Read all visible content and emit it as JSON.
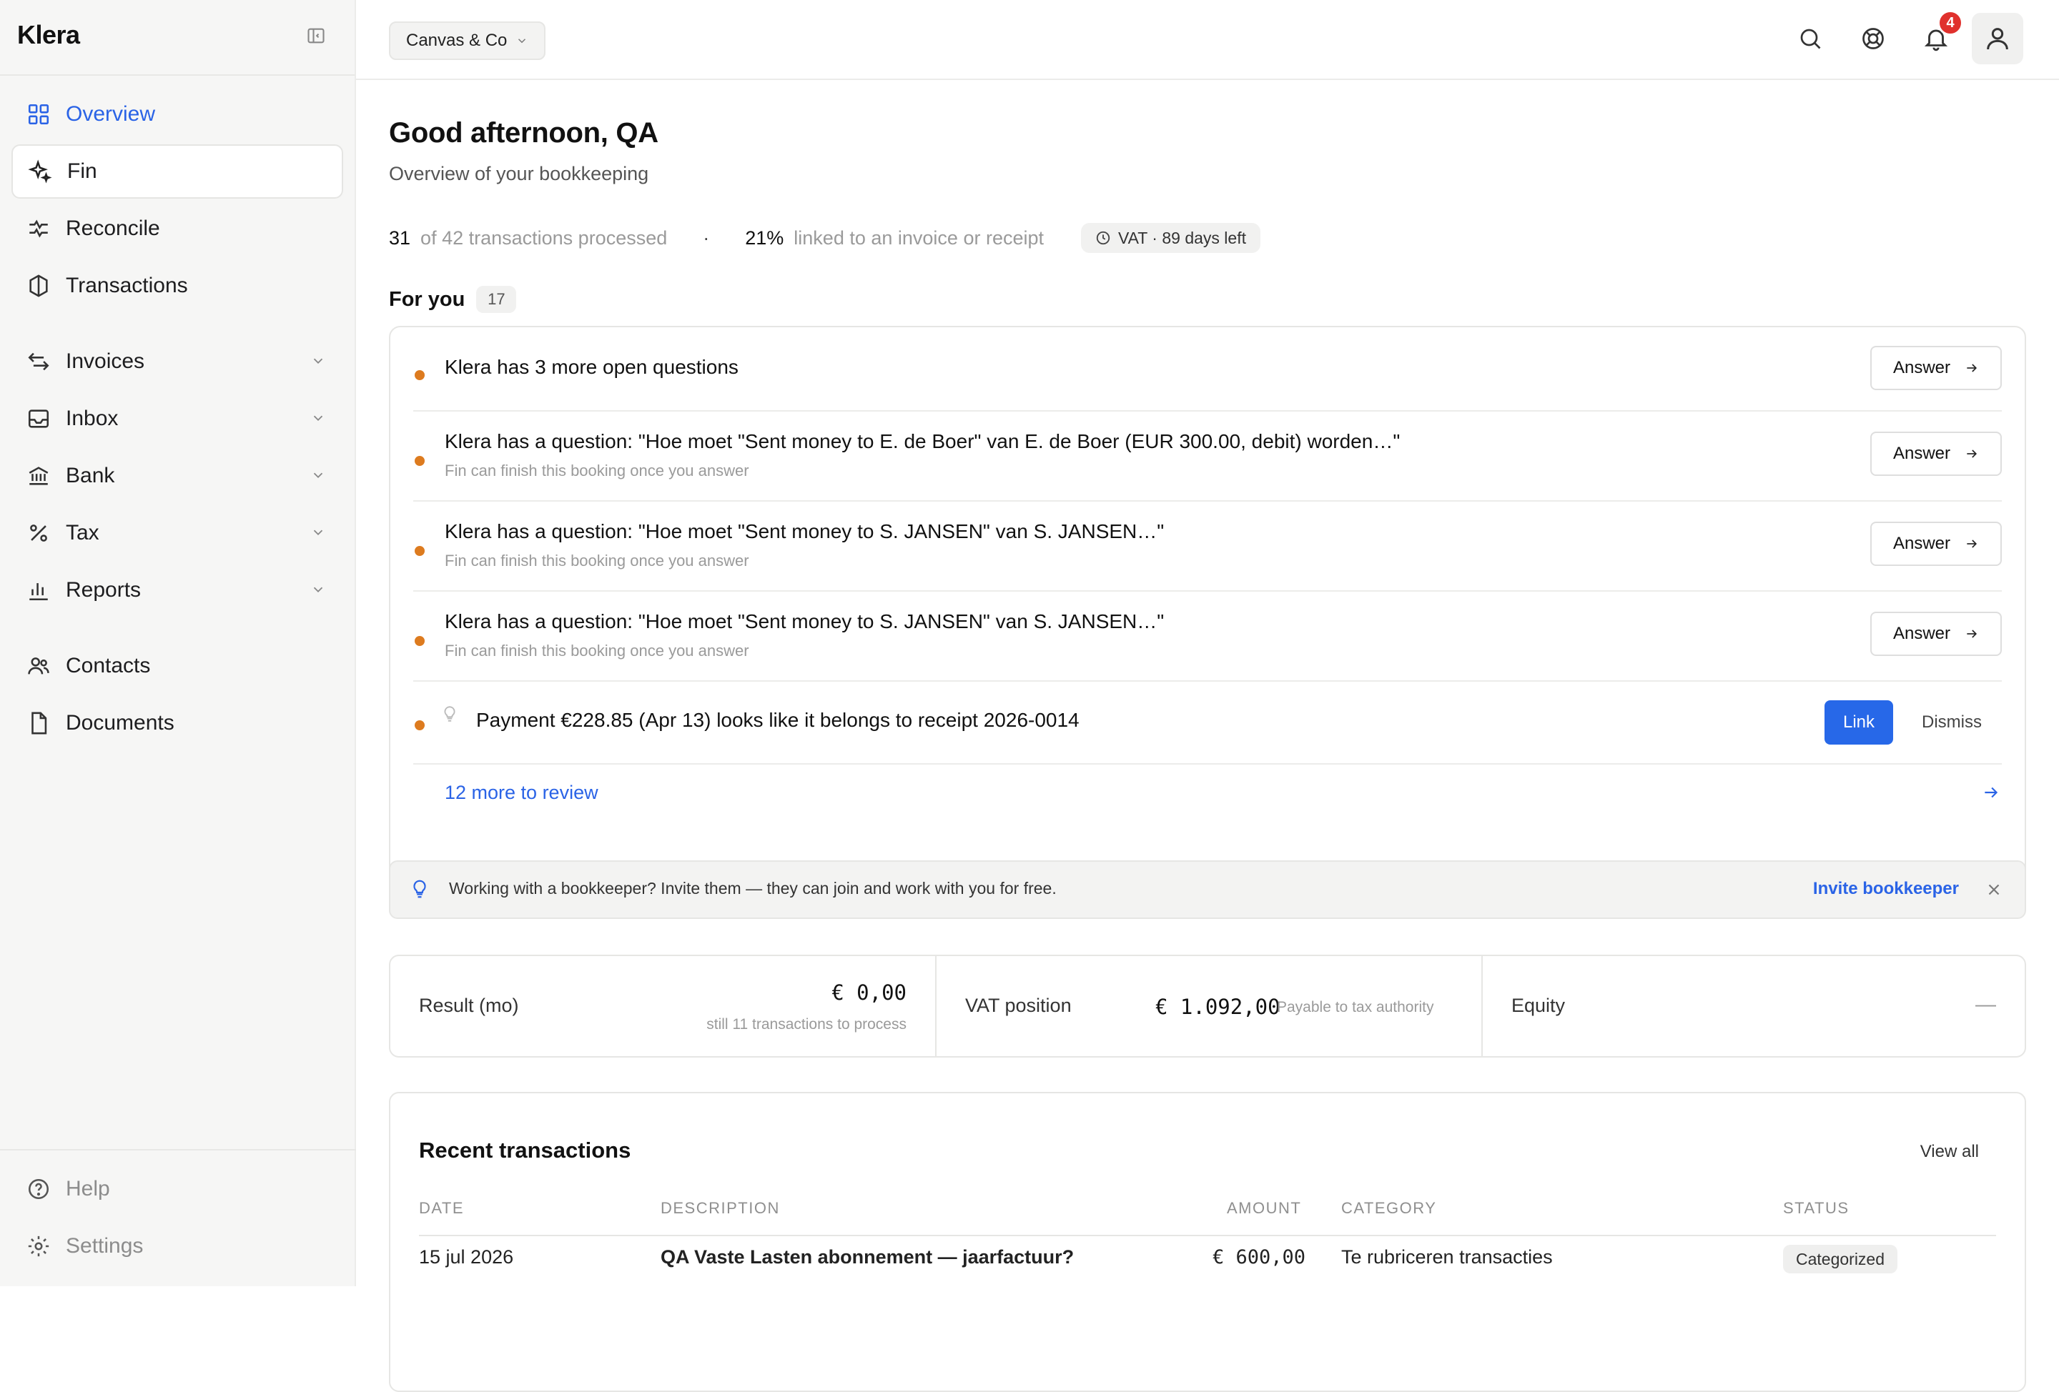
{
  "app": {
    "brand": "Klera"
  },
  "company": {
    "name": "Canvas & Co"
  },
  "notifications": {
    "count": "4"
  },
  "sidebar": {
    "items": [
      {
        "label": "Overview"
      },
      {
        "label": "Fin"
      },
      {
        "label": "Reconcile"
      },
      {
        "label": "Transactions"
      },
      {
        "label": "Invoices"
      },
      {
        "label": "Inbox"
      },
      {
        "label": "Bank"
      },
      {
        "label": "Tax"
      },
      {
        "label": "Reports"
      },
      {
        "label": "Contacts"
      },
      {
        "label": "Documents"
      }
    ],
    "bottom": [
      {
        "label": "Help"
      },
      {
        "label": "Settings"
      }
    ]
  },
  "main": {
    "greeting": "Good afternoon, QA",
    "subtitle": "Overview of your bookkeeping",
    "stats": {
      "processed_num": "31",
      "processed_text": "of 42 transactions processed",
      "separator": "·",
      "linked_num": "21%",
      "linked_text": "linked to an invoice or receipt",
      "vat_pill": "VAT · 89 days left"
    },
    "for_you": {
      "title": "For you",
      "count": "17",
      "rows": [
        {
          "title": "Klera has 3 more open questions",
          "hint": "",
          "action": "Answer"
        },
        {
          "title": "Klera has a question: \"Hoe moet \"Sent money to E. de Boer\" van E. de Boer (EUR 300.00, debit) worden…\"",
          "hint": "Fin can finish this booking once you answer",
          "action": "Answer"
        },
        {
          "title": "Klera has a question: \"Hoe moet \"Sent money to S. JANSEN\" van S. JANSEN…\"",
          "hint": "Fin can finish this booking once you answer",
          "action": "Answer"
        },
        {
          "title": "Klera has a question: \"Hoe moet \"Sent money to S. JANSEN\" van S. JANSEN…\"",
          "hint": "Fin can finish this booking once you answer",
          "action": "Answer"
        }
      ],
      "suggestion": {
        "title": "Payment €228.85 (Apr 13) looks like it belongs to receipt 2026-0014",
        "link": "Link",
        "dismiss": "Dismiss"
      },
      "more": "12 more to review"
    },
    "tip": {
      "text": "Working with a bookkeeper? Invite them — they can join and work with you for free.",
      "action": "Invite bookkeeper"
    },
    "metrics": {
      "result_label": "Result (mo)",
      "result_value": "€ 0,00",
      "result_note": "still 11 transactions to process",
      "vat_label": "VAT position",
      "vat_value": "€ 1.092,00",
      "vat_note": "Payable to tax authority",
      "equity_label": "Equity",
      "equity_value": "—"
    },
    "recent": {
      "title": "Recent transactions",
      "view_all": "View all",
      "columns": [
        "DATE",
        "DESCRIPTION",
        "AMOUNT",
        "CATEGORY",
        "STATUS"
      ],
      "rows": [
        {
          "date": "15 jul 2026",
          "description": "QA Vaste Lasten abonnement — jaarfactuur?",
          "amount": "€ 600,00",
          "category": "Te rubriceren transacties",
          "status": "Categorized"
        }
      ]
    }
  },
  "colors": {
    "accent": "#2a63e6",
    "button_primary": "#2768e8",
    "bullet": "#dd7b1f",
    "badge": "#e0312d"
  }
}
